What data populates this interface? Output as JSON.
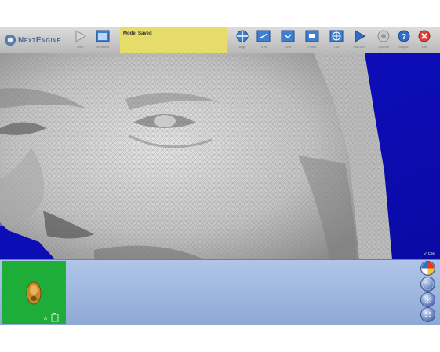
{
  "toolbar": {
    "logo_text": "NextEngine",
    "status_text": "Model Saved",
    "buttons": [
      {
        "key": "scan",
        "label": "Scan",
        "icon": "play-icon"
      },
      {
        "key": "windows",
        "label": "Windows",
        "icon": "window-icon"
      },
      {
        "key": "align",
        "label": "Align",
        "icon": "align-icon"
      },
      {
        "key": "trim",
        "label": "Trim",
        "icon": "trim-icon"
      },
      {
        "key": "fuse",
        "label": "Fuse",
        "icon": "fuse-icon"
      },
      {
        "key": "polish",
        "label": "Polish",
        "icon": "polish-icon"
      },
      {
        "key": "output",
        "label": "Out",
        "icon": "globe-icon"
      },
      {
        "key": "scanstudio",
        "label": "ScanStd",
        "icon": "play-icon"
      },
      {
        "key": "options",
        "label": "Options",
        "icon": "gear-icon"
      },
      {
        "key": "support",
        "label": "Support",
        "icon": "help-icon"
      },
      {
        "key": "exit",
        "label": "Exit",
        "icon": "close-icon"
      }
    ]
  },
  "viewport": {
    "view_label": "VIEW",
    "background_color": "#0d0dba"
  },
  "bottom_panel": {
    "thumbnail_label": "A",
    "side_buttons": [
      "texture-icon",
      "shading-icon",
      "wireframe-icon",
      "points-icon"
    ]
  }
}
